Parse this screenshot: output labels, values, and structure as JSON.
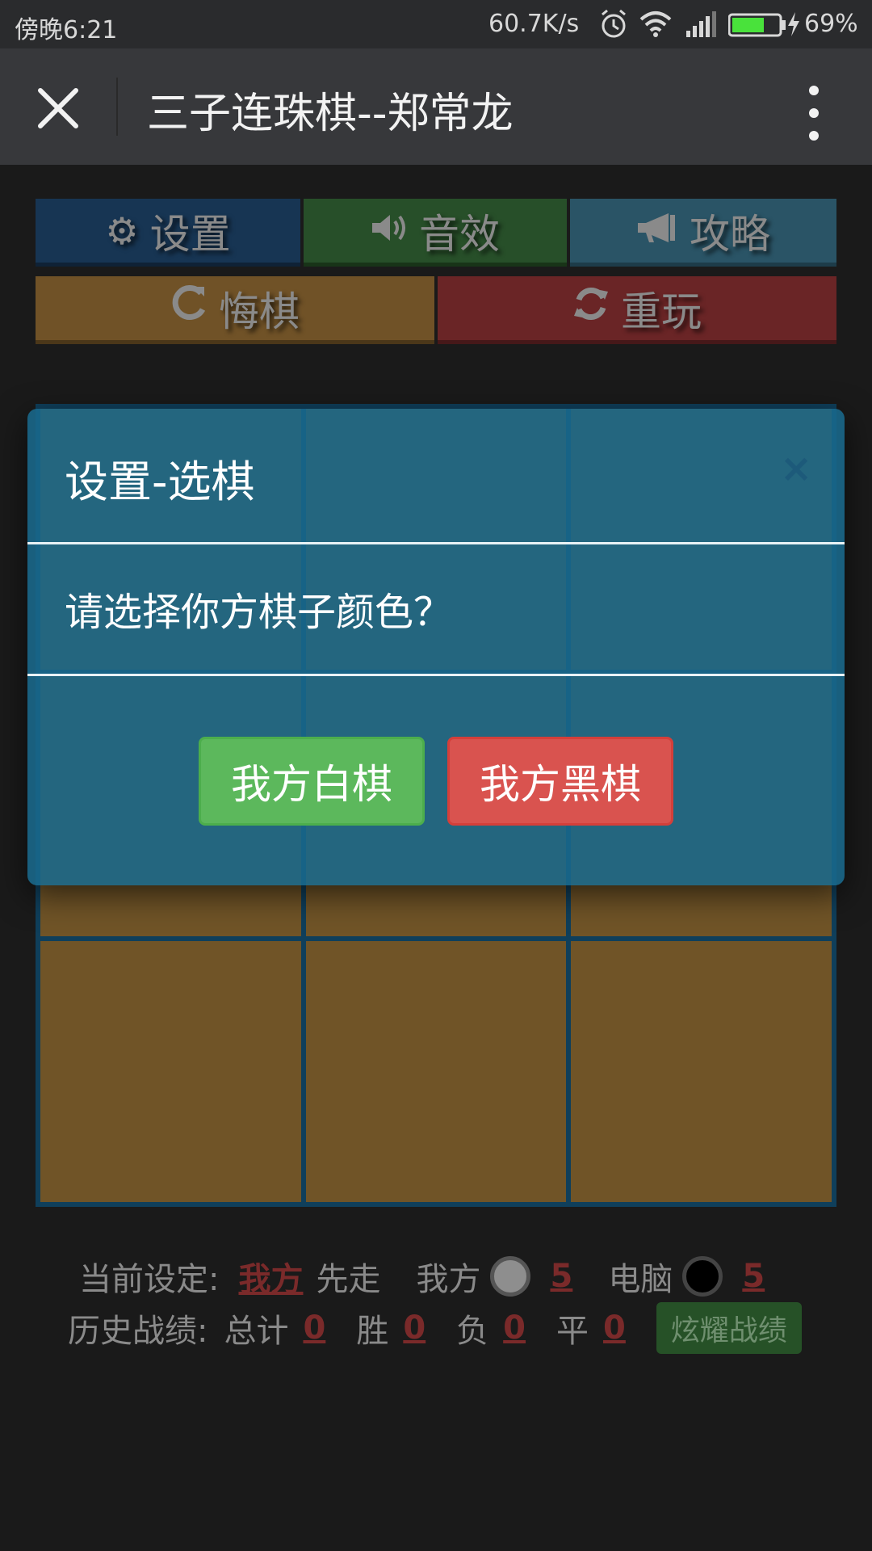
{
  "status_bar": {
    "time": "傍晚6:21",
    "network_speed": "60.7K/s",
    "battery_percent": "69%",
    "battery_level": 0.69,
    "icons": [
      "alarm-icon",
      "wifi-icon",
      "signal-icon",
      "battery-icon",
      "charging-icon"
    ]
  },
  "header": {
    "title": "三子连珠棋--郑常龙",
    "close_icon": "close-icon",
    "more_icon": "more-vertical-icon"
  },
  "toolbar": {
    "settings": {
      "label": "设置",
      "icon": "gear-icon",
      "color": "#173553"
    },
    "sound": {
      "label": "音效",
      "icon": "speaker-icon",
      "color": "#274f29"
    },
    "guide": {
      "label": "攻略",
      "icon": "megaphone-icon",
      "color": "#2a5466"
    },
    "undo": {
      "label": "悔棋",
      "icon": "undo-icon",
      "color": "#705227"
    },
    "restart": {
      "label": "重玩",
      "icon": "refresh-icon",
      "color": "#6a2526"
    }
  },
  "board": {
    "rows": 3,
    "cols": 3
  },
  "stats": {
    "current_label": "当前设定:",
    "first_player": "我方",
    "first_suffix": "先走",
    "me_label": "我方",
    "me_count": "5",
    "cpu_label": "电脑",
    "cpu_count": "5",
    "history_label": "历史战绩:",
    "total_label": "总计",
    "total": "0",
    "win_label": "胜",
    "win": "0",
    "lose_label": "负",
    "lose": "0",
    "draw_label": "平",
    "draw": "0",
    "glory_button": "炫耀战绩"
  },
  "modal": {
    "title": "设置-选棋",
    "close": "×",
    "question": "请选择你方棋子颜色？",
    "white_button": "我方白棋",
    "black_button": "我方黑棋",
    "colors": {
      "overlay": "#19698c",
      "white_btn": "#5cb85c",
      "black_btn": "#d9534f"
    }
  }
}
